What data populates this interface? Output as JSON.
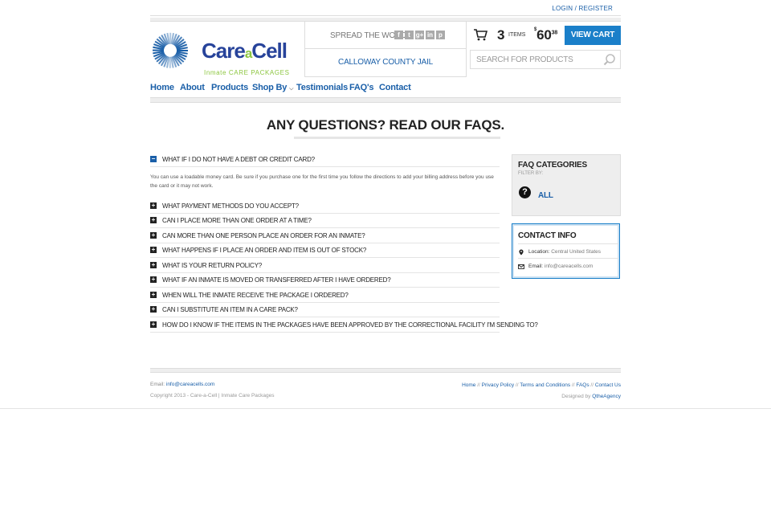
{
  "top": {
    "login_register": "LOGIN / REGISTER"
  },
  "logo": {
    "brand_care": "Care",
    "brand_a": "a",
    "brand_cell": "Cell",
    "tagline": "Inmate CARE PACKAGES"
  },
  "spread": {
    "label": "SPREAD THE WORD",
    "social": [
      "f",
      "t",
      "g+",
      "in",
      "p"
    ]
  },
  "facility": {
    "name": "CALLOWAY COUNTY JAIL"
  },
  "cart": {
    "count": "3",
    "items_label": "ITEMS",
    "currency": "$",
    "price_main": "60",
    "price_cents": "38",
    "view_cart": "VIEW CART"
  },
  "search": {
    "placeholder": "SEARCH FOR PRODUCTS"
  },
  "nav": {
    "items": [
      "Home",
      "About",
      "Products",
      "Shop By",
      "Testimonials",
      "FAQ's",
      "Contact"
    ]
  },
  "main": {
    "heading": "ANY QUESTIONS? READ OUR FAQS."
  },
  "faq": {
    "items": [
      {
        "q": "WHAT IF I DO NOT HAVE A DEBT OR CREDIT CARD?",
        "open": true
      },
      {
        "q": "WHAT PAYMENT METHODS DO YOU ACCEPT?"
      },
      {
        "q": "CAN I PLACE MORE THAN ONE ORDER AT A TIME?"
      },
      {
        "q": "CAN MORE THAN ONE PERSON PLACE AN ORDER FOR AN INMATE?"
      },
      {
        "q": "WHAT HAPPENS IF I PLACE AN ORDER AND ITEM IS OUT OF STOCK?"
      },
      {
        "q": "WHAT IS YOUR RETURN POLICY?"
      },
      {
        "q": "WHAT IF AN INMATE IS MOVED OR TRANSFERRED AFTER I HAVE ORDERED?"
      },
      {
        "q": "WHEN WILL THE INMATE RECEIVE THE PACKAGE I ORDERED?"
      },
      {
        "q": "CAN I SUBSTITUTE AN ITEM IN A CARE PACK?"
      },
      {
        "q": "HOW DO I KNOW IF THE ITEMS IN THE PACKAGES HAVE BEEN APPROVED BY THE CORRECTIONAL FACILITY I'M SENDING TO?"
      }
    ],
    "answer": "You can use a loadable money card.  Be sure if you purchase one for the first time you follow the directions to add your billing address before you use the card or it may not work."
  },
  "categories": {
    "title": "FAQ CATEGORIES",
    "filter_label": "FILTER BY:",
    "all": "ALL"
  },
  "contact": {
    "title": "CONTACT INFO",
    "location_label": "Location:",
    "location": "Central United States",
    "email_label": "Email:",
    "email": "info@careacells.com"
  },
  "footer": {
    "email_label": "Email:",
    "email": "info@careacells.com",
    "copyright": "Copyright 2013 - Care-a-Cell | Inmate Care Packages",
    "links": [
      "Home",
      "Privacy Policy",
      "Terms and Conditions",
      "FAQs",
      "Contact Us"
    ],
    "designed_by_label": "Designed by",
    "designed_by": "QtheAgency"
  },
  "colors": {
    "accent": "#1a7fc9",
    "link": "#1a5fa8",
    "brand_navy": "#27439a",
    "brand_green": "#8cc63f"
  }
}
